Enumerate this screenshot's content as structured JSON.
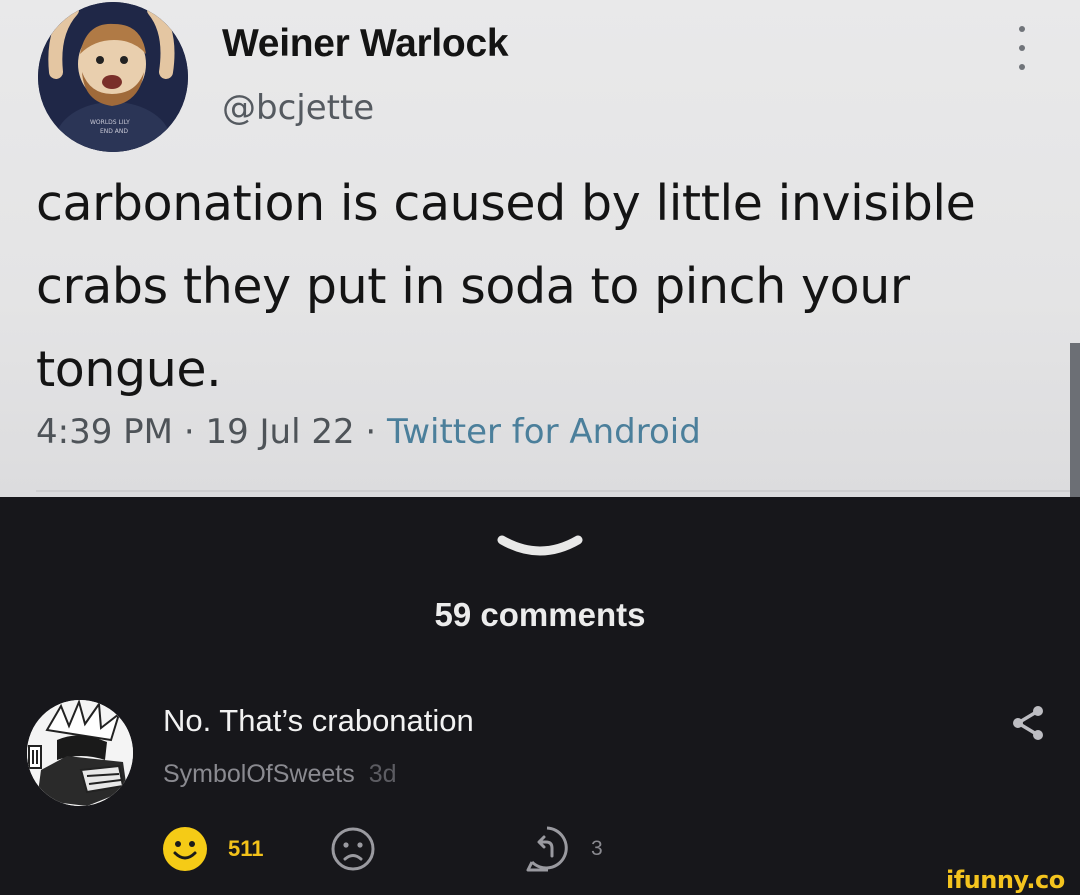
{
  "tweet": {
    "author_name": "Weiner Warlock",
    "handle": "@bcjette",
    "text": "carbonation is caused by little invisible crabs they put in soda to pinch your tongue.",
    "time": "4:39 PM",
    "date": "19 Jul 22",
    "source": "Twitter for Android",
    "separator": "·",
    "avatar_icon": "cartoon-character-avatar",
    "menu_icon": "more-vertical-icon"
  },
  "comments_section": {
    "collapse_icon": "chevron-down-icon",
    "count_label": "59 comments"
  },
  "comment": {
    "text": "No. That’s crabonation",
    "author": "SymbolOfSweets",
    "age": "3d",
    "avatar_icon": "manga-character-avatar",
    "share_icon": "share-icon",
    "smiles": "511",
    "smile_icon": "smile-icon",
    "unsmile_icon": "sad-face-icon",
    "reply_icon": "reply-icon",
    "replies": "3"
  },
  "watermark": "ifunny.co",
  "colors": {
    "tweet_bg": "#e6e6e7",
    "app_bg": "#17171b",
    "smile_yellow": "#f3c21a",
    "source_link": "#4b7f9b"
  }
}
